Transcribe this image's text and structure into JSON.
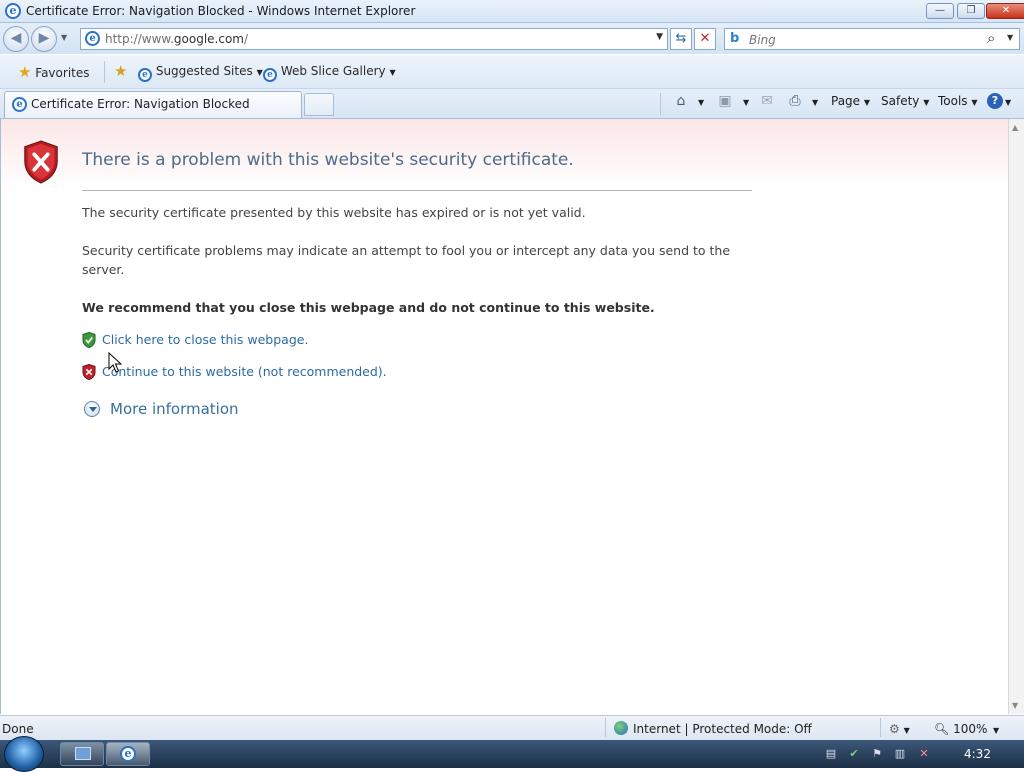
{
  "window": {
    "title": "Certificate Error: Navigation Blocked - Windows Internet Explorer",
    "minimize_label": "—",
    "restore_label": "❐",
    "close_label": "✕"
  },
  "navigation": {
    "back_glyph": "◀",
    "forward_glyph": "▶",
    "address_prefix": "http://www.",
    "address_domain": "google.com",
    "address_suffix": "/",
    "refresh_glyph": "⇆",
    "stop_glyph": "✕",
    "search_placeholder": "Bing",
    "search_glyph": "⌕"
  },
  "favorites_bar": {
    "favorites_label": "Favorites",
    "items": [
      {
        "label": "Suggested Sites"
      },
      {
        "label": "Web Slice Gallery"
      }
    ]
  },
  "tabs": [
    {
      "label": "Certificate Error: Navigation Blocked",
      "active": true
    }
  ],
  "command_bar": {
    "page_label": "Page",
    "safety_label": "Safety",
    "tools_label": "Tools",
    "help_glyph": "?"
  },
  "page": {
    "heading": "There is a problem with this website's security certificate.",
    "paragraph1": "The security certificate presented by this website has expired or is not yet valid.",
    "paragraph2": "Security certificate problems may indicate an attempt to fool you or intercept any data you send to the server.",
    "recommendation": "We recommend that you close this webpage and do not continue to this website.",
    "close_link": "Click here to close this webpage.",
    "continue_link": "Continue to this website (not recommended).",
    "more_info": "More information"
  },
  "status_bar": {
    "status": "Done",
    "zone": "Internet | Protected Mode: Off",
    "zoom": "100%"
  },
  "taskbar": {
    "clock": "4:32"
  },
  "colors": {
    "link": "#2d6aa3",
    "heading": "#4b6b8e",
    "error_red": "#c3222a",
    "ok_green": "#3a9a3a"
  }
}
